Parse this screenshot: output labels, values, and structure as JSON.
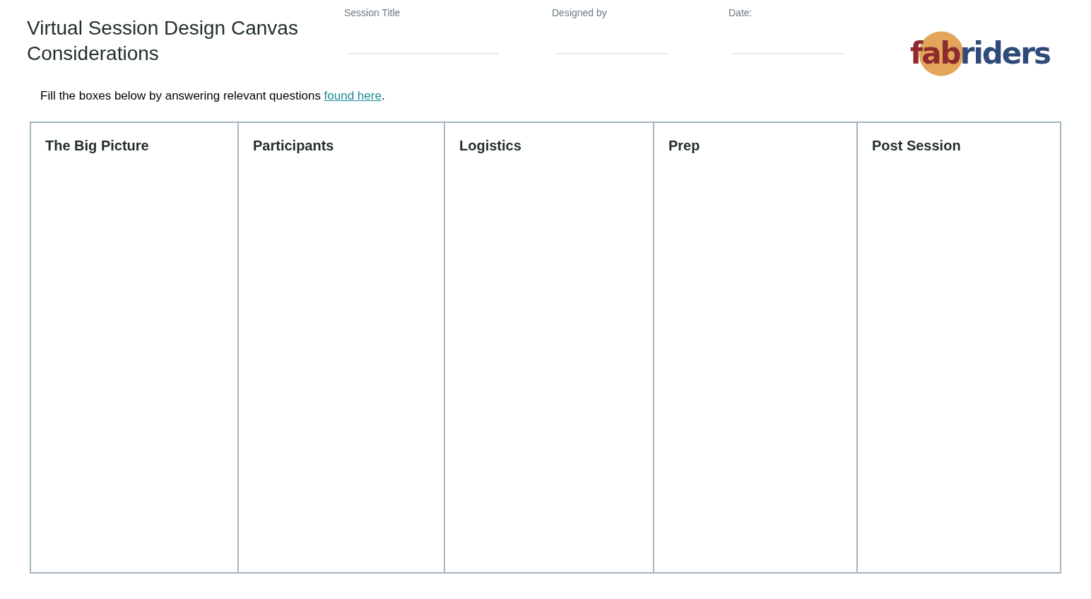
{
  "title": "Virtual Session Design Canvas Considerations",
  "fields": [
    {
      "label": "Session Title"
    },
    {
      "label": "Designed by"
    },
    {
      "label": "Date:"
    }
  ],
  "logo": {
    "part_1": "fab",
    "part_2": "riders"
  },
  "instruction": {
    "before": "Fill the boxes below by answering relevant questions ",
    "link": "found here",
    "after": "."
  },
  "columns": [
    {
      "heading": "The Big Picture"
    },
    {
      "heading": "Participants"
    },
    {
      "heading": "Logistics"
    },
    {
      "heading": "Prep"
    },
    {
      "heading": "Post Session"
    }
  ]
}
